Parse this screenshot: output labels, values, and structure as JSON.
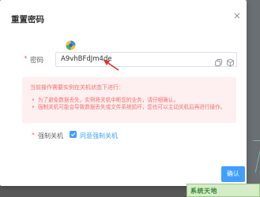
{
  "dialog": {
    "title": "重置密码"
  },
  "form": {
    "password_label": "密码",
    "password_value": "A9vhBFdJm4de",
    "required_mark": "*"
  },
  "alert": {
    "title": "当前操作需要实例在关机状态下进行：",
    "items": [
      "为了避免数据丢失，实例将关机中断您的业务，请仔细确认。",
      "强制关机可能会导致数据丢失或文件系统损坏，您也可以主动关机后再进行操作。"
    ]
  },
  "force_shutdown": {
    "label": "强制关机",
    "checkbox_label": "同意强制关机",
    "checked": true
  },
  "footer": {
    "confirm_label": "确认"
  },
  "watermark": {
    "text": "系统天地"
  },
  "colors": {
    "primary": "#409eff",
    "danger": "#f56c6c",
    "alert_bg": "#fef0f0",
    "annotation": "#e03030"
  }
}
